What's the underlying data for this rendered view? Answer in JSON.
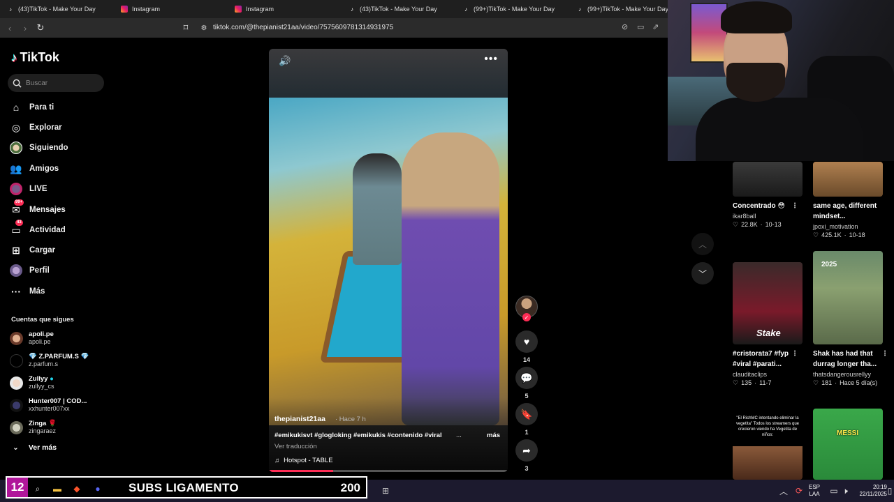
{
  "browser": {
    "tabs": [
      {
        "title": "(43)TikTok - Make Your Day",
        "icon": "tiktok-icon"
      },
      {
        "title": "Instagram",
        "icon": "instagram-icon"
      },
      {
        "title": "Instagram",
        "icon": "instagram-icon"
      },
      {
        "title": "(43)TikTok - Make Your Day",
        "icon": "tiktok-icon"
      },
      {
        "title": "(99+)TikTok - Make Your Day",
        "icon": "tiktok-icon"
      },
      {
        "title": "(99+)TikTok - Make Your Day",
        "icon": "tiktok-icon"
      }
    ],
    "url": "tiktok.com/@thepianist21aa/video/7575609781314931975"
  },
  "sidebar": {
    "logo": "TikTok",
    "search_placeholder": "Buscar",
    "nav": [
      {
        "label": "Para ti",
        "icon": "home-icon"
      },
      {
        "label": "Explorar",
        "icon": "compass-icon"
      },
      {
        "label": "Siguiendo",
        "icon": "following-avatar-icon"
      },
      {
        "label": "Amigos",
        "icon": "friends-icon"
      },
      {
        "label": "LIVE",
        "icon": "live-icon"
      },
      {
        "label": "Mensajes",
        "icon": "messages-icon",
        "badge": "99+"
      },
      {
        "label": "Actividad",
        "icon": "activity-icon",
        "badge": "43"
      },
      {
        "label": "Cargar",
        "icon": "upload-icon"
      },
      {
        "label": "Perfil",
        "icon": "profile-avatar-icon"
      },
      {
        "label": "Más",
        "icon": "more-icon"
      }
    ],
    "following_title": "Cuentas que sigues",
    "following": [
      {
        "name": "apoli.pe",
        "handle": "apoli.pe"
      },
      {
        "name": "💎 Z.PARFUM.S 💎",
        "handle": "z.parfum.s"
      },
      {
        "name": "Zullyy",
        "handle": "zullyy_cs",
        "verified": true
      },
      {
        "name": "Hunter007 | COD...",
        "handle": "xxhunter007xx"
      },
      {
        "name": "Zinga 🌹",
        "handle": "zingaraez"
      }
    ],
    "see_more": "Ver más"
  },
  "video": {
    "author": "thepianist21aa",
    "time": "· Hace 7 h",
    "caption": "#emikukisvt #glogloking #emikukis #contenido #viral",
    "ellipsis": "...",
    "more": "más",
    "translate": "Ver traducción",
    "music": "Hotspot - TABLE",
    "progress": 0.27
  },
  "actions": {
    "likes": "14",
    "comments": "5",
    "saves": "1",
    "shares": "3"
  },
  "feed": [
    {
      "title": "Concentrado 😳",
      "user": "ikar8ball",
      "views": "22.8K",
      "date": "10-13"
    },
    {
      "title": "same age, different mindset...",
      "user": "jpoxi_motivation",
      "views": "425.1K",
      "date": "10-18"
    },
    {
      "title": "#cristorata7 #fyp #viral #parati...",
      "user": "clauditaclips",
      "views": "135",
      "date": "11-7",
      "thumb_text": "Stake"
    },
    {
      "title": "Shak has had that durrag longer tha...",
      "user": "thatsdangerousrellyy",
      "views": "181",
      "date": "Hace 5 día(s)",
      "thumb_text": "2025"
    },
    {
      "title": "",
      "user": "",
      "views": "",
      "date": "",
      "thumb_text": "\"El RichMC intentando eliminar la vegetita\" Todos los streamers que crecieron viendo ha Vegetita de niños:"
    },
    {
      "title": "",
      "user": "",
      "views": "",
      "date": "",
      "thumb_text": "MESSI"
    }
  ],
  "overlay": {
    "subs_count": "12",
    "subs_label": "SUBS LIGAMENTO",
    "subs_goal": "200"
  },
  "taskbar": {
    "lang_top": "ESP",
    "lang_bottom": "LAA",
    "time": "20:19",
    "date": "22/11/2025"
  }
}
